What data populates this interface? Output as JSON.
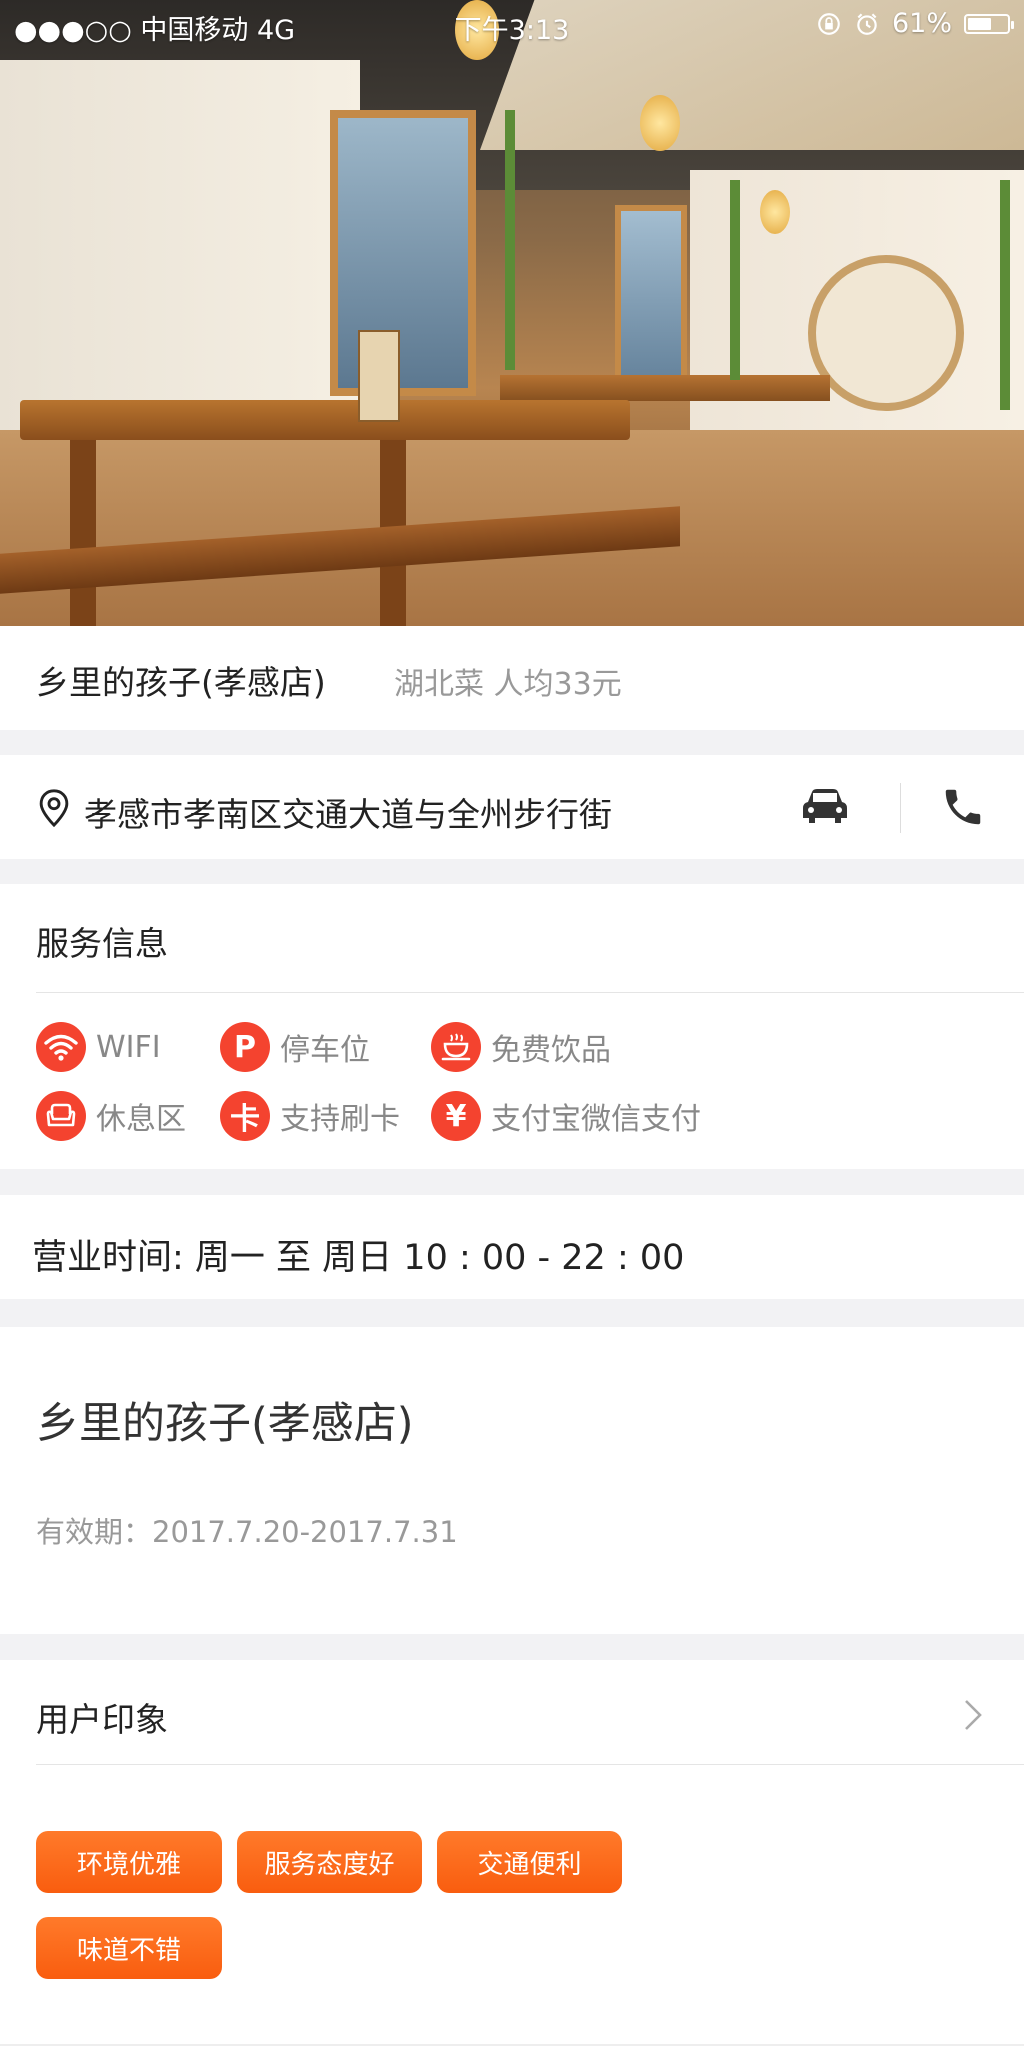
{
  "status_bar": {
    "carrier": "●●●○○ 中国移动   4G",
    "time": "下午3:13",
    "battery_text": "61%",
    "battery_level": 0.61
  },
  "hero": {
    "image_desc_icon": "restaurant-photo"
  },
  "shop": {
    "name": "乡里的孩子(孝感店)",
    "meta": "湖北菜 人均33元"
  },
  "address": {
    "text": "孝感市孝南区交通大道与全州步行街"
  },
  "service": {
    "title": "服务信息",
    "items": [
      {
        "label": "WIFI",
        "icon": "wifi-icon"
      },
      {
        "label": "停车位",
        "icon": "parking-icon",
        "glyph": "P"
      },
      {
        "label": "免费饮品",
        "icon": "cup-icon"
      },
      {
        "label": "休息区",
        "icon": "sofa-icon"
      },
      {
        "label": "支持刷卡",
        "icon": "card-icon",
        "glyph": "卡"
      },
      {
        "label": "支付宝微信支付",
        "icon": "yuan-icon",
        "glyph": "¥"
      }
    ]
  },
  "hours": {
    "text": "营业时间: 周一 至 周日 10 : 00 - 22 : 00"
  },
  "deal": {
    "title": "乡里的孩子(孝感店)",
    "validity": "有效期：2017.7.20-2017.7.31"
  },
  "impression": {
    "title": "用户印象",
    "tags": [
      "环境优雅",
      "服务态度好",
      "交通便利",
      "味道不错"
    ]
  },
  "colors": {
    "accent_red": "#f4432f",
    "tag_orange": "#f9650f"
  }
}
